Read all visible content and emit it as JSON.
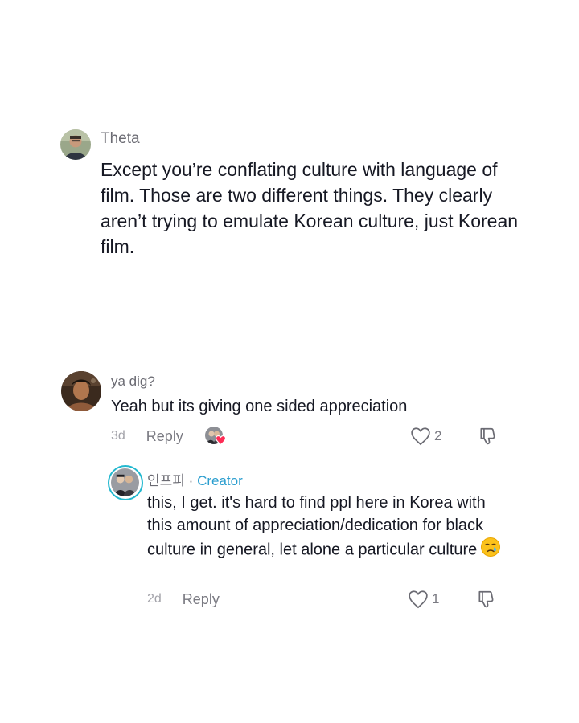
{
  "quoted_comment": {
    "username": "Theta",
    "text": "Except you’re conflating culture with language of film. Those are two different things. They clearly aren’t trying to emulate Korean culture, just Korean film."
  },
  "comments": [
    {
      "username": "ya dig?",
      "text": "Yeah but its giving one sided appreciation",
      "time": "3d",
      "reply_label": "Reply",
      "likes": "2",
      "creator_liked": true
    },
    {
      "username": "인프피",
      "separator": "·",
      "creator_label": "Creator",
      "text": "this, I get. it's hard to find ppl here in Korea with this amount of appreciation/dedication for black culture in general, let alone a particular culture",
      "emoji": "crying-face-emoji",
      "time": "2d",
      "reply_label": "Reply",
      "likes": "1"
    }
  ],
  "colors": {
    "text": "#161823",
    "muted": "#6b6b73",
    "creator": "#2b9ecf",
    "heart": "#fe2c55",
    "creator_ring": "#22b8cf"
  }
}
